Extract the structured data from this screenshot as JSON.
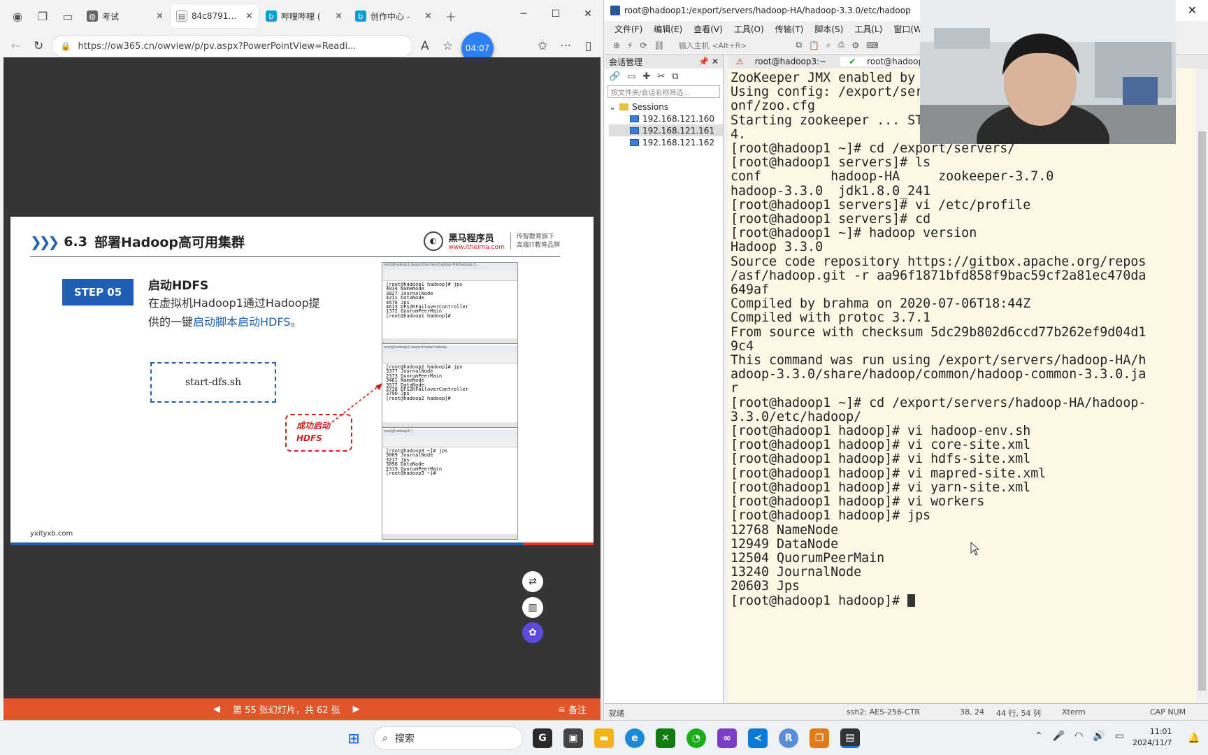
{
  "browser": {
    "tabs": [
      {
        "label": "考试",
        "icon": "globe-icon",
        "color": "#555555"
      },
      {
        "label": "84c879129...",
        "icon": "page-icon",
        "color": "#777777"
      },
      {
        "label": "哔哩哔哩 (",
        "icon": "bilibili-icon",
        "color": "#00a1d6"
      },
      {
        "label": "创作中心 - ",
        "icon": "bilibili-icon",
        "color": "#00a1d6"
      }
    ],
    "url": "https://ow365.cn/owview/p/pv.aspx?PowerPointView=Readi...",
    "timer": "04:07"
  },
  "slide": {
    "section": "6.3",
    "title": "部署Hadoop高可用集群",
    "logo_name": "黑马程序员",
    "logo_url": "www.itheima.com",
    "logo_tagline_1": "传智教育旗下",
    "logo_tagline_2": "高端IT教育品牌",
    "step_badge": "STEP 05",
    "step_title": "启动HDFS",
    "desc_1": "在虚拟机Hadoop1通过Hadoop提",
    "desc_2": "供的一键",
    "desc_link": "启动脚本启动HDFS",
    "desc_3": "。",
    "command": "start-dfs.sh",
    "callout_1": "成功启动",
    "callout_2": "HDFS",
    "footer": "yxityxb.com",
    "shot1_title": "root@hadoop1:/export/servers/hadoop-HA/hadoop-3...",
    "shot1_text": "[root@hadoop1 hadoop]# jps\n4034 NameNode\n3827 JournalNode\n4211 DataNode\n4676 Jps\n4613 DFSZKFailoverController\n1372 QuorumPeerMain\n[root@hadoop1 hadoop]# ",
    "shot2_title": "root@hadoop2:/export/data/hadoop",
    "shot2_text": "[root@hadoop2 hadoop]# jps\n3377 JournalNode\n2373 QuorumPeerMain\n3461 NameNode\n3577 DataNode\n3738 DFSZKFailoverController\n3790 Jps\n[root@hadoop2 hadoop]# ",
    "shot3_title": "root@hadoop3:~",
    "shot3_text": "[root@hadoop3 ~]# jps\n3009 JournalNode\n3217 Jps\n3098 DataNode\n2319 QuorumPeerMain\n[root@hadoop3 ~]# "
  },
  "viewer": {
    "page_info": "第 55 张幻灯片，共 62 张",
    "notes_label": "备注"
  },
  "xshell": {
    "title": "root@hadoop1:/export/servers/hadoop-HA/hadoop-3.3.0/etc/hadoop",
    "menu": [
      "文件(F)",
      "编辑(E)",
      "查看(V)",
      "工具(O)",
      "传输(T)",
      "脚本(S)",
      "工具(L)",
      "窗口(W)"
    ],
    "host_placeholder": "输入主机 <Alt+R>",
    "session_panel_title": "会话管理",
    "session_filter_placeholder": "按文件夹/会话名称筛选...",
    "sessions_root": "Sessions",
    "sessions": [
      "192.168.121.160",
      "192.168.121.161",
      "192.168.121.162"
    ],
    "tab_1": "root@hadoop3:~",
    "tab_2": "root@hadoop1:/exp",
    "terminal_lines": "ZooKeeper JMX enabled by default\nUsing config: /export/servers/zookeeper-3.7.0/bin/../c\nonf/zoo.cfg\nStarting zookeeper ... STARTED                        50\n4.\n[root@hadoop1 ~]# cd /export/servers/\n[root@hadoop1 servers]# ls\nconf         hadoop-HA     zookeeper-3.7.0\nhadoop-3.3.0  jdk1.8.0_241\n[root@hadoop1 servers]# vi /etc/profile\n[root@hadoop1 servers]# cd\n[root@hadoop1 ~]# hadoop version\nHadoop 3.3.0\nSource code repository https://gitbox.apache.org/repos\n/asf/hadoop.git -r aa96f1871bfd858f9bac59cf2a81ec470da\n649af\nCompiled by brahma on 2020-07-06T18:44Z\nCompiled with protoc 3.7.1\nFrom source with checksum 5dc29b802d6ccd77b262ef9d04d1\n9c4\nThis command was run using /export/servers/hadoop-HA/h\nadoop-3.3.0/share/hadoop/common/hadoop-common-3.3.0.ja\nr\n[root@hadoop1 ~]# cd /export/servers/hadoop-HA/hadoop-\n3.3.0/etc/hadoop/\n[root@hadoop1 hadoop]# vi hadoop-env.sh\n[root@hadoop1 hadoop]# vi core-site.xml\n[root@hadoop1 hadoop]# vi hdfs-site.xml\n[root@hadoop1 hadoop]# vi mapred-site.xml\n[root@hadoop1 hadoop]# vi yarn-site.xml\n[root@hadoop1 hadoop]# vi workers\n[root@hadoop1 hadoop]# jps\n12768 NameNode\n12949 DataNode\n12504 QuorumPeerMain\n13240 JournalNode\n20603 Jps\n[root@hadoop1 hadoop]# ",
    "status_ready": "就绪",
    "status_ssh": "ssh2: AES-256-CTR",
    "status_pos": "38, 24",
    "status_size": "44 行, 54 列",
    "status_term": "Xterm",
    "status_caps": "CAP NUM"
  },
  "taskbar": {
    "search_placeholder": "搜索",
    "time": "11:01",
    "date": "2024/11/7"
  }
}
